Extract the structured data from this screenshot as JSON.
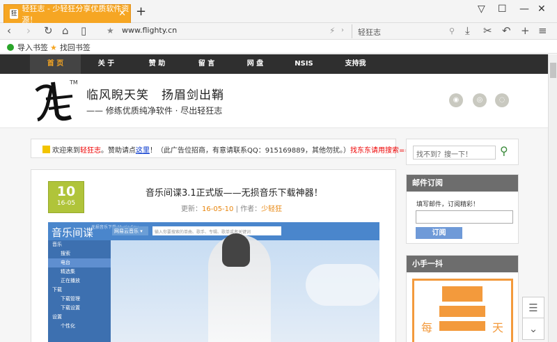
{
  "browser": {
    "tab_title": "轻狂志 - 少轻狂分享优质软件资源！",
    "tab_close": "✕",
    "new_tab": "+",
    "url": "www.flighty.cn",
    "search_text": "轻狂志",
    "bookmarks": [
      {
        "label": "导入书签"
      },
      {
        "label": "找回书签"
      }
    ]
  },
  "nav": {
    "items": [
      "首 页",
      "关 于",
      "赞 助",
      "留 言",
      "网 盘",
      "NSIS",
      "支持我"
    ],
    "active": 0
  },
  "header": {
    "tm": "TM",
    "slogan": "临风睨天笑　扬眉剑出鞘",
    "subtitle": "—— 修练优质纯净软件 · 尽出轻狂志"
  },
  "notice": {
    "p1": "欢迎来到",
    "site": "轻狂志",
    "p2": "。赞助请点",
    "link": "这里",
    "p3": "！（此广告位招商，有意请联系QQ：915169889，其他勿扰。）",
    "promo": "找东东请用搜索====>>"
  },
  "post": {
    "day": "10",
    "month": "16-05",
    "title": "音乐间谍3.1正式版——无损音乐下载神器！",
    "meta_prefix": "更新：",
    "meta_date": "16-05-10",
    "meta_sep": "| 作者：",
    "meta_author": "少轻狂",
    "app": {
      "name": "音乐间谍",
      "tag": "无损音乐下载 Music Spy",
      "select": "网易云音乐 ▾",
      "search_placeholder": "输入你要搜索的单曲、歌手、专辑、歌单或者关键词",
      "menu": [
        "音乐",
        "搜索",
        "电台",
        "精选集",
        "正在播放",
        "下载",
        "下载管理",
        "下载设置",
        "设置",
        "个性化"
      ]
    }
  },
  "sidebar": {
    "search_placeholder": "找不到？搜一下！",
    "subscribe_title": "邮件订阅",
    "subscribe_tip": "填写邮件，订阅精彩！",
    "subscribe_button": "订阅",
    "hand_title": "小手一抖",
    "hand_left": "每",
    "hand_right": "天"
  },
  "colors": {
    "accent": "#f6a623",
    "nav_bg": "#2f2f2f",
    "date_green": "#b0c43a",
    "orange": "#f39a3c"
  }
}
